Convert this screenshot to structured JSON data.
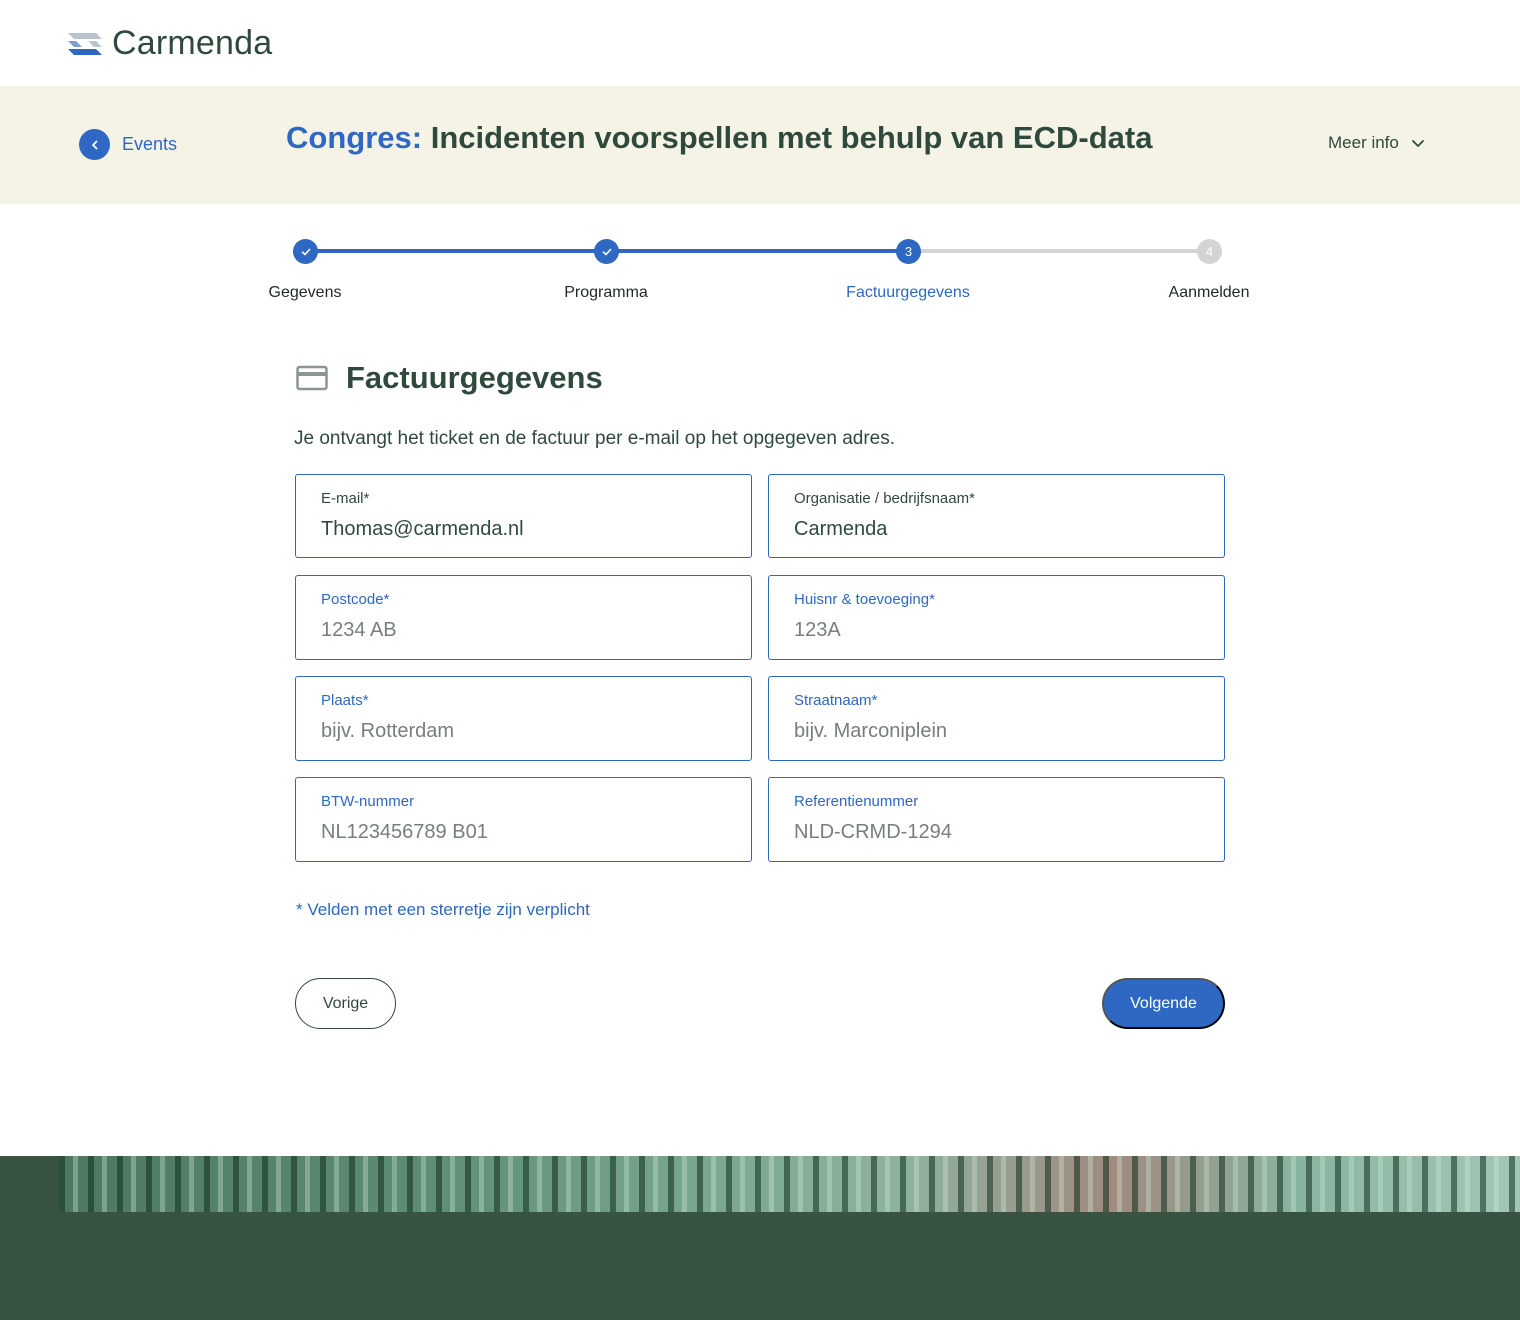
{
  "brand": {
    "name": "Carmenda"
  },
  "event": {
    "back_label": "Events",
    "title_prefix": "Congres:",
    "title": "Incidenten voorspellen met behulp van ECD-data",
    "more_info": "Meer info"
  },
  "stepper": {
    "steps": [
      {
        "number": "1",
        "label": "Gegevens",
        "state": "done"
      },
      {
        "number": "2",
        "label": "Programma",
        "state": "done"
      },
      {
        "number": "3",
        "label": "Factuurgegevens",
        "state": "active"
      },
      {
        "number": "4",
        "label": "Aanmelden",
        "state": "todo"
      }
    ]
  },
  "form": {
    "section_title": "Factuurgegevens",
    "intro": "Je ontvangt het ticket en de factuur per e-mail op het opgegeven adres.",
    "fields": {
      "email": {
        "label": "E-mail*",
        "value": "Thomas@carmenda.nl"
      },
      "organisation": {
        "label": "Organisatie / bedrijfsnaam*",
        "value": "Carmenda"
      },
      "postcode": {
        "label": "Postcode*",
        "placeholder": "1234 AB"
      },
      "house_number": {
        "label": "Huisnr & toevoeging*",
        "placeholder": "123A"
      },
      "city": {
        "label": "Plaats*",
        "placeholder": "bijv. Rotterdam"
      },
      "street": {
        "label": "Straatnaam*",
        "placeholder": "bijv. Marconiplein"
      },
      "vat": {
        "label": "BTW-nummer",
        "placeholder": "NL123456789 B01"
      },
      "reference": {
        "label": "Referentienummer",
        "placeholder": "NLD-CRMD-1294"
      }
    },
    "required_note": "* Velden met een sterretje zijn verplicht",
    "prev_label": "Vorige",
    "next_label": "Volgende"
  },
  "icons": {
    "back": "chevron-left-icon",
    "more": "chevron-down-icon",
    "step_done": "check-icon",
    "section": "credit-card-icon"
  },
  "colors": {
    "accent": "#2e68c2",
    "text": "#2f4a3c",
    "event_bar": "#f5f3e6",
    "footer": "#385342",
    "step_inactive": "#d4d4d4"
  }
}
